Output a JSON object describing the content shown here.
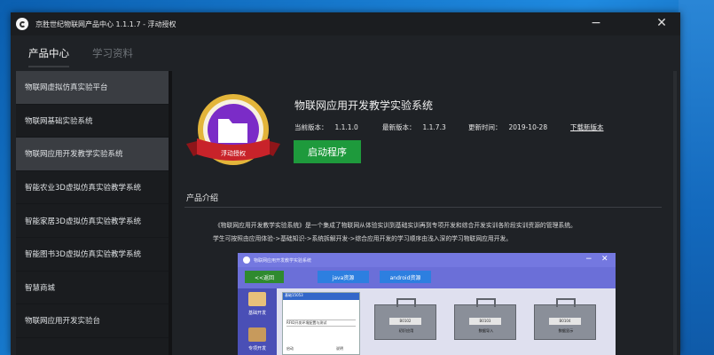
{
  "window": {
    "title": "京胜世纪物联网产品中心 1.1.1.7 - 浮动授权",
    "controls": {
      "minimize": "−",
      "close": "✕"
    }
  },
  "tabs": [
    {
      "label": "产品中心",
      "active": true
    },
    {
      "label": "学习资料",
      "active": false
    }
  ],
  "sidebar": {
    "items": [
      {
        "label": "物联网虚拟仿真实验平台",
        "selected": true
      },
      {
        "label": "物联网基础实验系统",
        "selected": false
      },
      {
        "label": "物联网应用开发教学实验系统",
        "selected": true
      },
      {
        "label": "智能农业3D虚拟仿真实验教学系统",
        "selected": false
      },
      {
        "label": "智能家居3D虚拟仿真实验教学系统",
        "selected": false
      },
      {
        "label": "智能图书3D虚拟仿真实验教学系统",
        "selected": false
      },
      {
        "label": "智慧商城",
        "selected": false
      },
      {
        "label": "物联网应用开发实验台",
        "selected": false
      }
    ]
  },
  "product": {
    "badge_text": "浮动授权",
    "title": "物联网应用开发教学实验系统",
    "meta": [
      {
        "key": "当前版本：",
        "value": "1.1.1.0"
      },
      {
        "key": "最新版本：",
        "value": "1.1.7.3"
      },
      {
        "key": "更新时间：",
        "value": "2019-10-28"
      }
    ],
    "download_link": "下载新版本",
    "start_button": "启动程序",
    "section_label": "产品介绍",
    "description": [
      "《物联网应用开发教学实验系统》是一个集成了物联网从体验实训到基础实训再到专项开发和综合开发实训各阶段实训资源的管理系统。",
      "学生可按照由应用体验->基础知识->系统拆解开发->综合应用开发的学习顺序由浅入深的学习物联网应用开发。"
    ],
    "screenshot": {
      "title": "物联网应用开发教学实验系统",
      "tabs": [
        "<<返回",
        "java资源",
        "android资源"
      ],
      "left_labels": [
        "基础开发",
        "专项开发"
      ],
      "selected_card": {
        "head": "基础15053",
        "lines": "RFID开发环境配置与测试",
        "foot_left": "启动",
        "foot_right": "说明"
      },
      "cases": [
        {
          "code": "B0102",
          "name": "初识应用"
        },
        {
          "code": "B0103",
          "name": "数据导入"
        },
        {
          "code": "B0104",
          "name": "数据显示"
        }
      ],
      "colors": {
        "frame": "#6b6fd8",
        "tab": "#2d7fe0",
        "body": "#dfe0ef"
      }
    }
  },
  "colors": {
    "accent_green": "#1e9a3c",
    "badge_purple": "#7b2cc7",
    "badge_ribbon": "#c8232a",
    "badge_gold": "#e3b53a"
  }
}
